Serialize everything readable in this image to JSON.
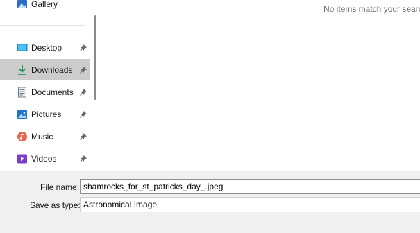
{
  "sidebar": {
    "gallery": {
      "label": "Gallery",
      "icon": "gallery-icon"
    },
    "items": [
      {
        "label": "Desktop",
        "icon": "desktop-icon",
        "pinned": true
      },
      {
        "label": "Downloads",
        "icon": "downloads-icon",
        "pinned": true,
        "selected": true
      },
      {
        "label": "Documents",
        "icon": "documents-icon",
        "pinned": true
      },
      {
        "label": "Pictures",
        "icon": "pictures-icon",
        "pinned": true
      },
      {
        "label": "Music",
        "icon": "music-icon",
        "pinned": true
      },
      {
        "label": "Videos",
        "icon": "videos-icon",
        "pinned": true
      }
    ]
  },
  "content": {
    "empty_message": "No items match your search."
  },
  "form": {
    "file_name": {
      "label": "File name:",
      "value": "shamrocks_for_st_patricks_day_.jpeg"
    },
    "save_as_type": {
      "label": "Save as type:",
      "value": "Astronomical Image"
    }
  },
  "colors": {
    "selected_bg": "#cccccc",
    "footer_bg": "#f0f0f0"
  }
}
